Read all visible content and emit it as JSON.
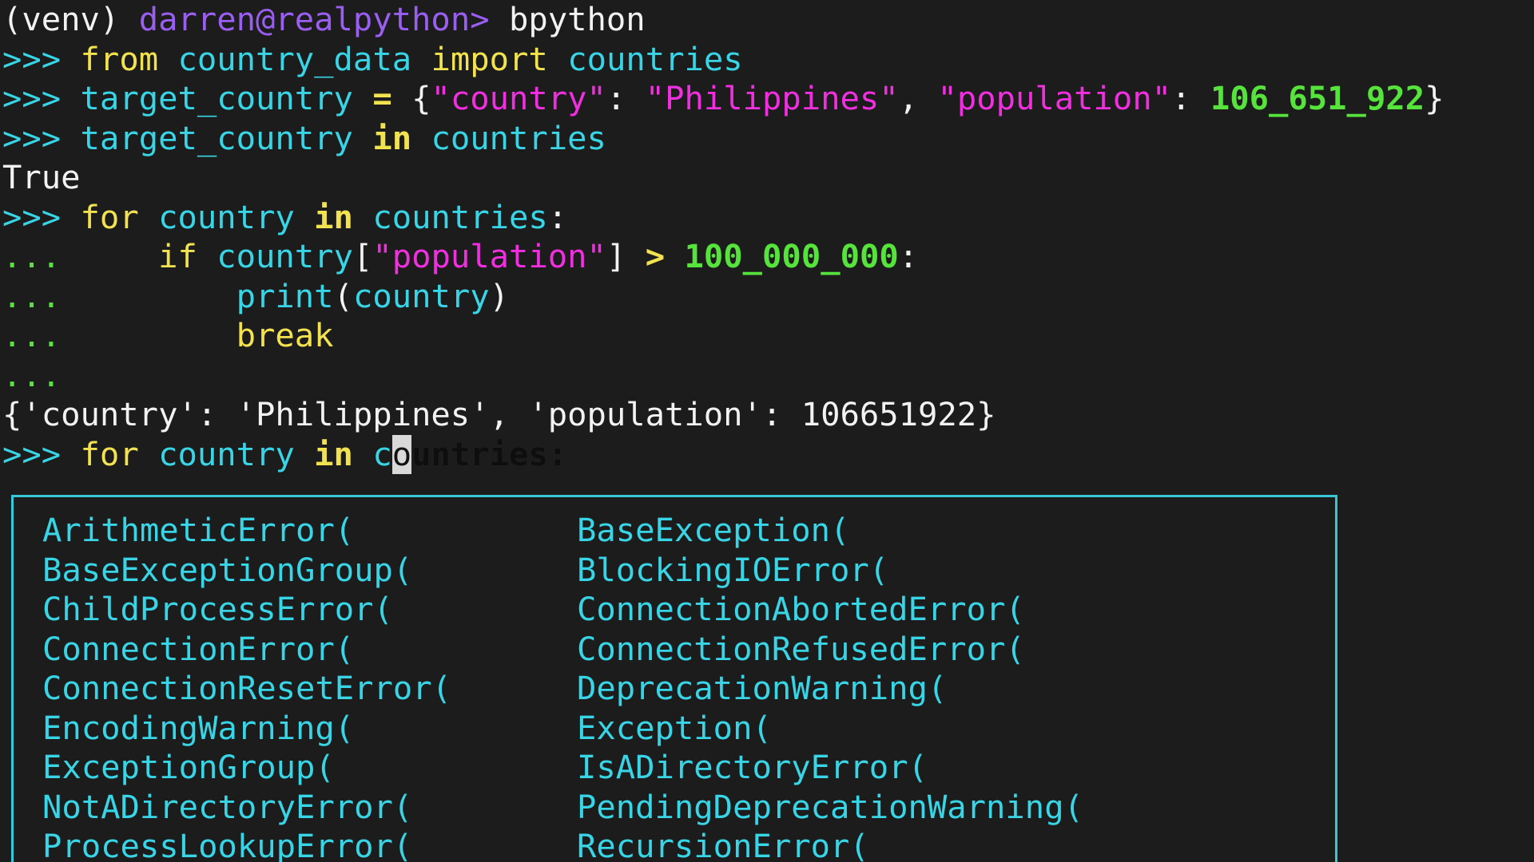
{
  "terminal": {
    "lines": [
      {
        "tokens": [
          [
            "(venv) ",
            "white"
          ],
          [
            "darren@realpython>",
            "user"
          ],
          [
            " bpython",
            "white"
          ]
        ]
      },
      {
        "tokens": [
          [
            ">>> ",
            "prompt"
          ],
          [
            "from",
            "kw"
          ],
          [
            " ",
            "white"
          ],
          [
            "country_data",
            "name"
          ],
          [
            " ",
            "white"
          ],
          [
            "import",
            "kw"
          ],
          [
            " ",
            "white"
          ],
          [
            "countries",
            "name"
          ]
        ]
      },
      {
        "tokens": [
          [
            ">>> ",
            "prompt"
          ],
          [
            "target_country",
            "name"
          ],
          [
            " ",
            "white"
          ],
          [
            "=",
            "op"
          ],
          [
            " ",
            "white"
          ],
          [
            "{",
            "punct"
          ],
          [
            "\"country\"",
            "str"
          ],
          [
            ": ",
            "punct"
          ],
          [
            "\"Philippines\"",
            "str"
          ],
          [
            ", ",
            "punct"
          ],
          [
            "\"population\"",
            "str"
          ],
          [
            ": ",
            "punct"
          ],
          [
            "106_651_922",
            "num"
          ],
          [
            "}",
            "punct"
          ]
        ]
      },
      {
        "tokens": [
          [
            ">>> ",
            "prompt"
          ],
          [
            "target_country",
            "name"
          ],
          [
            " ",
            "white"
          ],
          [
            "in",
            "op"
          ],
          [
            " ",
            "white"
          ],
          [
            "countries",
            "name"
          ]
        ]
      },
      {
        "tokens": [
          [
            "True",
            "white"
          ]
        ]
      },
      {
        "tokens": [
          [
            ">>> ",
            "prompt"
          ],
          [
            "for",
            "kw"
          ],
          [
            " ",
            "white"
          ],
          [
            "country",
            "name"
          ],
          [
            " ",
            "white"
          ],
          [
            "in",
            "op"
          ],
          [
            " ",
            "white"
          ],
          [
            "countries",
            "name"
          ],
          [
            ":",
            "punct"
          ]
        ]
      },
      {
        "tokens": [
          [
            "... ",
            "cont"
          ],
          [
            "    ",
            "white"
          ],
          [
            "if",
            "kw"
          ],
          [
            " ",
            "white"
          ],
          [
            "country",
            "name"
          ],
          [
            "[",
            "punct"
          ],
          [
            "\"population\"",
            "str"
          ],
          [
            "]",
            "punct"
          ],
          [
            " ",
            "white"
          ],
          [
            ">",
            "op"
          ],
          [
            " ",
            "white"
          ],
          [
            "100_000_000",
            "num"
          ],
          [
            ":",
            "punct"
          ]
        ]
      },
      {
        "tokens": [
          [
            "... ",
            "cont"
          ],
          [
            "        ",
            "white"
          ],
          [
            "print",
            "name"
          ],
          [
            "(",
            "punct"
          ],
          [
            "country",
            "name"
          ],
          [
            ")",
            "punct"
          ]
        ]
      },
      {
        "tokens": [
          [
            "... ",
            "cont"
          ],
          [
            "        ",
            "white"
          ],
          [
            "break",
            "kw"
          ]
        ]
      },
      {
        "tokens": [
          [
            "... ",
            "cont"
          ]
        ]
      },
      {
        "tokens": [
          [
            "{'country': 'Philippines', 'population': 106651922}",
            "white"
          ]
        ]
      },
      {
        "tokens": [
          [
            ">>> ",
            "prompt"
          ],
          [
            "for",
            "kw"
          ],
          [
            " ",
            "white"
          ],
          [
            "country",
            "name"
          ],
          [
            " ",
            "white"
          ],
          [
            "in",
            "op"
          ],
          [
            " ",
            "white"
          ],
          [
            "c",
            "name"
          ],
          [
            "o",
            "cursor"
          ],
          [
            "untries:",
            "ghost"
          ]
        ]
      }
    ]
  },
  "completion": {
    "left_column": [
      "ArithmeticError(",
      "BaseExceptionGroup(",
      "ChildProcessError(",
      "ConnectionError(",
      "ConnectionResetError(",
      "EncodingWarning(",
      "ExceptionGroup(",
      "NotADirectoryError(",
      "ProcessLookupError("
    ],
    "right_column": [
      "BaseException(",
      "BlockingIOError(",
      "ConnectionAbortedError(",
      "ConnectionRefusedError(",
      "DeprecationWarning(",
      "Exception(",
      "IsADirectoryError(",
      "PendingDeprecationWarning(",
      "RecursionError("
    ]
  }
}
